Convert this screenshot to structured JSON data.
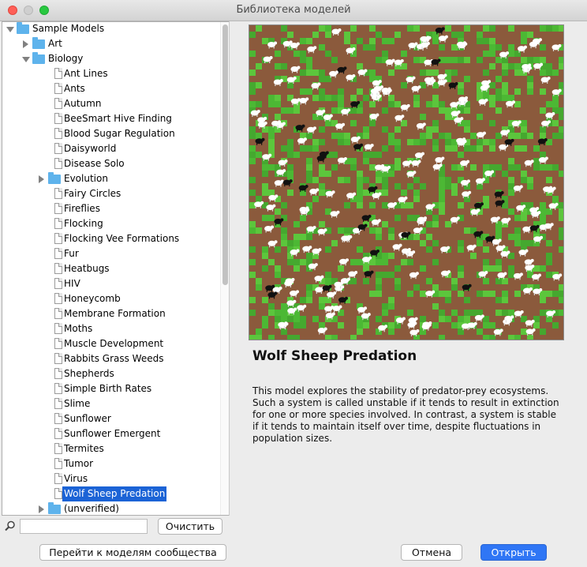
{
  "window": {
    "title": "Библиотека моделей"
  },
  "tree": {
    "items": [
      {
        "label": "Sample Models",
        "type": "folder",
        "level": 0,
        "state": "open"
      },
      {
        "label": "Art",
        "type": "folder",
        "level": 1,
        "state": "closed"
      },
      {
        "label": "Biology",
        "type": "folder",
        "level": 1,
        "state": "open"
      },
      {
        "label": "Ant Lines",
        "type": "model",
        "level": 2
      },
      {
        "label": "Ants",
        "type": "model",
        "level": 2
      },
      {
        "label": "Autumn",
        "type": "model",
        "level": 2
      },
      {
        "label": "BeeSmart Hive Finding",
        "type": "model",
        "level": 2
      },
      {
        "label": "Blood Sugar Regulation",
        "type": "model",
        "level": 2
      },
      {
        "label": "Daisyworld",
        "type": "model",
        "level": 2
      },
      {
        "label": "Disease Solo",
        "type": "model",
        "level": 2
      },
      {
        "label": "Evolution",
        "type": "folder",
        "level": 2,
        "state": "closed"
      },
      {
        "label": "Fairy Circles",
        "type": "model",
        "level": 2
      },
      {
        "label": "Fireflies",
        "type": "model",
        "level": 2
      },
      {
        "label": "Flocking",
        "type": "model",
        "level": 2
      },
      {
        "label": "Flocking Vee Formations",
        "type": "model",
        "level": 2
      },
      {
        "label": "Fur",
        "type": "model",
        "level": 2
      },
      {
        "label": "Heatbugs",
        "type": "model",
        "level": 2
      },
      {
        "label": "HIV",
        "type": "model",
        "level": 2
      },
      {
        "label": "Honeycomb",
        "type": "model",
        "level": 2
      },
      {
        "label": "Membrane Formation",
        "type": "model",
        "level": 2
      },
      {
        "label": "Moths",
        "type": "model",
        "level": 2
      },
      {
        "label": "Muscle Development",
        "type": "model",
        "level": 2
      },
      {
        "label": "Rabbits Grass Weeds",
        "type": "model",
        "level": 2
      },
      {
        "label": "Shepherds",
        "type": "model",
        "level": 2
      },
      {
        "label": "Simple Birth Rates",
        "type": "model",
        "level": 2
      },
      {
        "label": "Slime",
        "type": "model",
        "level": 2
      },
      {
        "label": "Sunflower",
        "type": "model",
        "level": 2
      },
      {
        "label": "Sunflower Emergent",
        "type": "model",
        "level": 2
      },
      {
        "label": "Termites",
        "type": "model",
        "level": 2
      },
      {
        "label": "Tumor",
        "type": "model",
        "level": 2
      },
      {
        "label": "Virus",
        "type": "model",
        "level": 2
      },
      {
        "label": "Wolf Sheep Predation",
        "type": "model",
        "level": 2,
        "selected": true
      },
      {
        "label": "(unverified)",
        "type": "folder",
        "level": 2,
        "state": "closed"
      }
    ]
  },
  "search": {
    "value": "",
    "clear_label": "Очистить"
  },
  "buttons": {
    "community": "Перейти к моделям сообщества",
    "cancel": "Отмена",
    "open": "Открыть"
  },
  "detail": {
    "title": "Wolf Sheep Predation",
    "description": "This model explores the stability of predator-prey ecosystems. Such a system is called unstable if it tends to result in extinction for one or more species involved. In contrast, a system is stable if it tends to maintain itself over time, despite fluctuations in population sizes."
  },
  "colors": {
    "selection": "#1b63d6",
    "folder": "#5eb3ec",
    "open_button": "#2f76f5",
    "dirt": "#8b5a3c",
    "grass": "#4cb834"
  }
}
